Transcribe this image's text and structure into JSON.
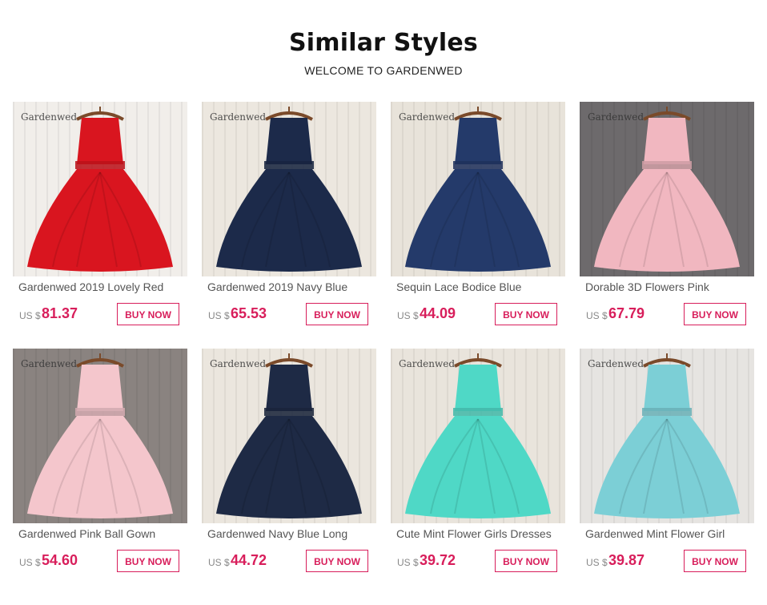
{
  "header": {
    "title": "Similar Styles",
    "subtitle": "WELCOME TO GARDENWED"
  },
  "products": [
    {
      "watermark": "Gardenwed",
      "name": "Gardenwed 2019 Lovely Red",
      "currency": "US $",
      "price": "81.37",
      "button": "BUY NOW",
      "dress_color": "#d9151f",
      "bg_color": "#f1eeea"
    },
    {
      "watermark": "Gardenwed",
      "name": "Gardenwed 2019 Navy Blue",
      "currency": "US $",
      "price": "65.53",
      "button": "BUY NOW",
      "dress_color": "#1c2a4a",
      "bg_color": "#ece7df"
    },
    {
      "watermark": "Gardenwed",
      "name": "Sequin Lace Bodice Blue",
      "currency": "US $",
      "price": "44.09",
      "button": "BUY NOW",
      "dress_color": "#243a6a",
      "bg_color": "#e8e3da"
    },
    {
      "watermark": "Gardenwed",
      "name": "Dorable 3D Flowers Pink",
      "currency": "US $",
      "price": "67.79",
      "button": "BUY NOW",
      "dress_color": "#f1b7c0",
      "bg_color": "#6d6a6c"
    },
    {
      "watermark": "Gardenwed",
      "name": "Gardenwed Pink Ball Gown",
      "currency": "US $",
      "price": "54.60",
      "button": "BUY NOW",
      "dress_color": "#f4c6cc",
      "bg_color": "#8a8380"
    },
    {
      "watermark": "Gardenwed",
      "name": "Gardenwed Navy Blue Long",
      "currency": "US $",
      "price": "44.72",
      "button": "BUY NOW",
      "dress_color": "#1e2a45",
      "bg_color": "#ebe6de"
    },
    {
      "watermark": "Gardenwed",
      "name": "Cute Mint Flower Girls Dresses",
      "currency": "US $",
      "price": "39.72",
      "button": "BUY NOW",
      "dress_color": "#4fd8c6",
      "bg_color": "#e9e4dc"
    },
    {
      "watermark": "Gardenwed",
      "name": "Gardenwed Mint Flower Girl",
      "currency": "US $",
      "price": "39.87",
      "button": "BUY NOW",
      "dress_color": "#7ccfd6",
      "bg_color": "#e6e4e1"
    }
  ]
}
